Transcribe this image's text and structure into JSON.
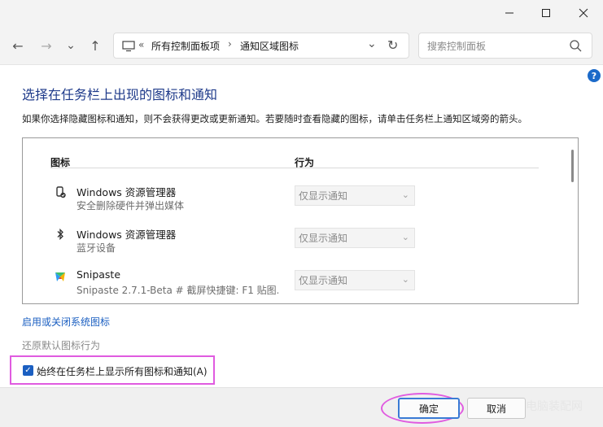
{
  "window": {
    "minimize_icon": "minimize-icon",
    "maximize_icon": "maximize-icon",
    "close_icon": "close-icon"
  },
  "nav": {
    "back": "←",
    "forward": "→",
    "recent": "⌄",
    "up": "↑"
  },
  "address": {
    "chevrons": "«",
    "crumb1": "所有控制面板项",
    "sep": "›",
    "crumb2": "通知区域图标",
    "dropdown": "⌄",
    "refresh": "↻"
  },
  "search": {
    "placeholder": "搜索控制面板"
  },
  "help": {
    "label": "?"
  },
  "page": {
    "heading": "选择在任务栏上出现的图标和通知",
    "description": "如果你选择隐藏图标和通知，则不会获得更改或更新通知。若要随时查看隐藏的图标，请单击任务栏上通知区域旁的箭头。"
  },
  "list": {
    "col_icon": "图标",
    "col_behavior": "行为",
    "rows": [
      {
        "name": "Windows 资源管理器",
        "sub": "安全删除硬件并弹出媒体",
        "behavior": "仅显示通知",
        "icon": "usb-safe-remove-icon"
      },
      {
        "name": "Windows 资源管理器",
        "sub": "蓝牙设备",
        "behavior": "仅显示通知",
        "icon": "bluetooth-icon"
      },
      {
        "name": "Snipaste",
        "sub": "Snipaste 2.7.1-Beta # 截屏快捷键: F1 贴图...",
        "behavior": "仅显示通知",
        "icon": "snipaste-icon"
      }
    ]
  },
  "links": {
    "system_icons": "启用或关闭系统图标",
    "restore": "还原默认图标行为"
  },
  "checkbox": {
    "label": "始终在任务栏上显示所有图标和通知(A)",
    "checked": true
  },
  "buttons": {
    "ok": "确定",
    "cancel": "取消"
  },
  "watermark": "电脑装配网"
}
